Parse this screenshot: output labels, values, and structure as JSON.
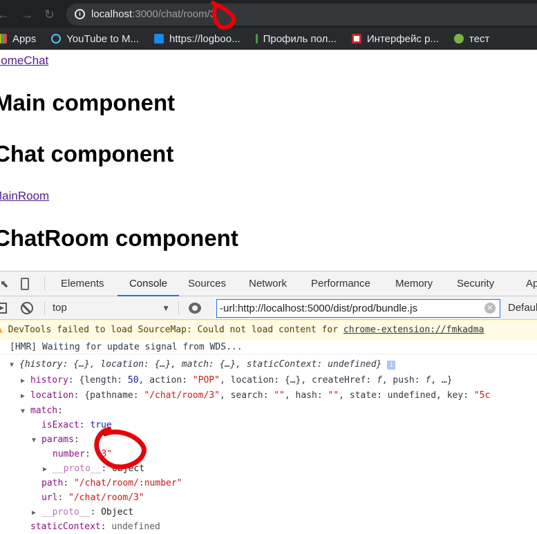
{
  "browser": {
    "url_host": "localhost",
    "url_path": ":3000/chat/room/3",
    "bookmarks": [
      {
        "label": "Apps",
        "icon": "apps-grid-icon"
      },
      {
        "label": "YouTube to M...",
        "icon": "cloud-download-icon"
      },
      {
        "label": "https://logboo...",
        "icon": "book-icon"
      },
      {
        "label": "Профиль пол...",
        "icon": "cursor-icon"
      },
      {
        "label": "Интерфейс р...",
        "icon": "headphones-icon"
      },
      {
        "label": "тест",
        "icon": "w-logo-icon"
      }
    ]
  },
  "page": {
    "link1": "HomeChat",
    "h1": "Main component",
    "h2": "Chat component",
    "link2": "MainRoom",
    "h3": "ChatRoom component"
  },
  "devtools": {
    "tabs": [
      "Elements",
      "Console",
      "Sources",
      "Network",
      "Performance",
      "Memory",
      "Security",
      "Ap"
    ],
    "active_tab": "Console",
    "context": "top",
    "filter": "-url:http://localhost:5000/dist/prod/bundle.js",
    "levels": "Defaul",
    "warning_text": "DevTools failed to load SourceMap: Could not load content for ",
    "warning_link": "chrome-extension://fmkadma",
    "log": "[HMR] Waiting for update signal from WDS...",
    "obj_summary": "{history: {…}, location: {…}, match: {…}, staticContext: undefined}",
    "history": {
      "key": "history",
      "length": "50",
      "action": "\"POP\"",
      "rest1": ", location: {…}, createHref: ",
      "f": "f",
      "rest2": ", push: ",
      "rest3": ", …}"
    },
    "location": {
      "key": "location",
      "pathname": "\"/chat/room/3\"",
      "search": "\"\"",
      "hash": "\"\"",
      "tail": ", state: undefined, key: ",
      "key_val": "\"5c"
    },
    "match": {
      "key": "match",
      "isExact": "true",
      "params": "params",
      "number": "\"3\"",
      "proto": "__proto__",
      "object": "Object",
      "path": "\"/chat/room/:number\"",
      "url": "\"/chat/room/3\""
    },
    "staticContext": "undefined"
  },
  "colors": {
    "accent": "#1a73e8",
    "annotation": "#e8000b"
  }
}
